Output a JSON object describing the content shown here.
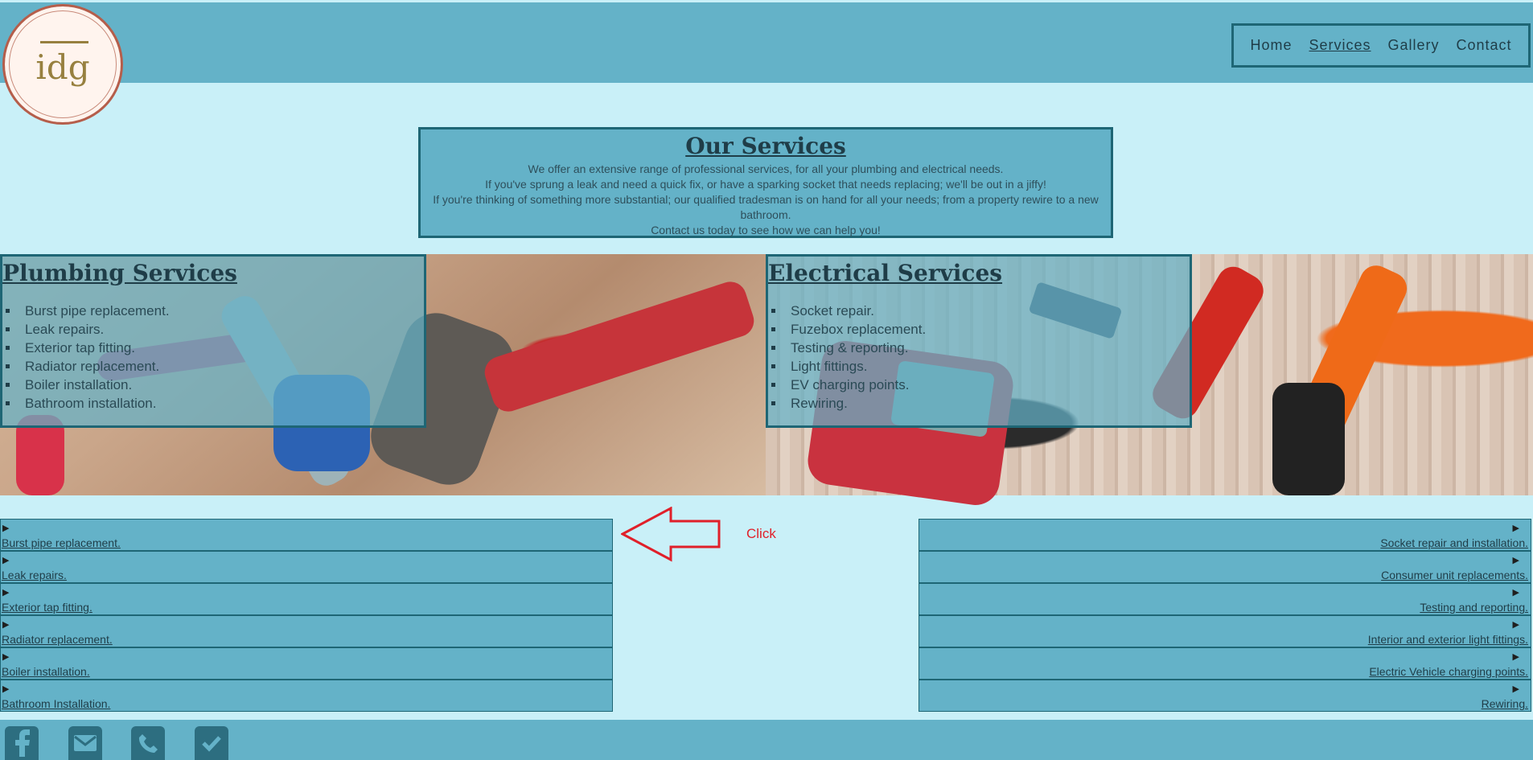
{
  "logo": {
    "text": "idg"
  },
  "nav": {
    "items": [
      {
        "label": "Home"
      },
      {
        "label": "Services"
      },
      {
        "label": "Gallery"
      },
      {
        "label": "Contact"
      }
    ]
  },
  "services": {
    "title": "Our Services",
    "lines": [
      "We offer an extensive range of professional services, for all your plumbing and electrical needs.",
      "If you've sprung a leak and need a quick fix, or have a sparking socket that needs replacing; we'll be out in a jiffy!",
      "If you're thinking of something more substantial; our qualified tradesman is on hand for all your needs; from a property rewire to a new bathroom.",
      "Contact us today to see how we can help you!"
    ]
  },
  "plumbing": {
    "title": "Plumbing Services",
    "items": [
      "Burst pipe replacement.",
      "Leak repairs.",
      "Exterior tap fitting.",
      "Radiator replacement.",
      "Boiler installation.",
      "Bathroom installation."
    ]
  },
  "electrical": {
    "title": "Electrical Services",
    "items": [
      "Socket repair.",
      "Fuzebox replacement.",
      "Testing & reporting.",
      "Light fittings.",
      "EV charging points.",
      "Rewiring."
    ]
  },
  "plumbing_details": [
    "Burst pipe replacement.",
    "Leak repairs.",
    "Exterior tap fitting.",
    "Radiator replacement.",
    "Boiler installation.",
    "Bathroom Installation."
  ],
  "electrical_details": [
    "Socket repair and installation.",
    "Consumer unit replacements.",
    "Testing and reporting.",
    "Interior and exterior light fittings.",
    "Electric Vehicle charging points.",
    "Rewiring."
  ],
  "annotation": {
    "text": "Click",
    "color": "#e0202a"
  },
  "colors": {
    "background": "#c9f0f8",
    "panel": "#64b2c8",
    "border": "#1e6675"
  },
  "footer": {
    "icons": [
      "facebook-icon",
      "email-icon",
      "phone-icon",
      "check-icon"
    ]
  }
}
